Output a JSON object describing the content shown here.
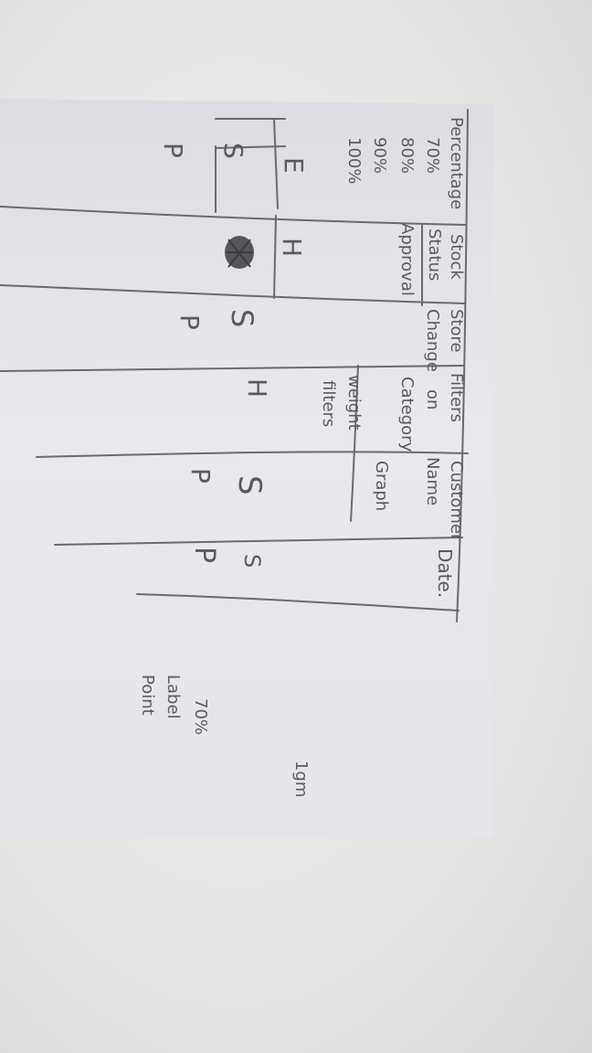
{
  "columns": [
    {
      "header_lines": [
        "Percentage",
        "70%",
        "80%",
        "90%",
        "100%"
      ],
      "cells": [
        "E",
        "S",
        "P"
      ]
    },
    {
      "header_lines": [
        "Stock",
        "Status",
        "Approval"
      ],
      "cells": [
        "H",
        ""
      ]
    },
    {
      "header_lines": [
        "Store",
        "Change"
      ],
      "cells": [
        "S",
        "P"
      ]
    },
    {
      "header_lines": [
        "Filters",
        "on",
        "Category",
        "weight",
        "filters"
      ],
      "cells": [
        "H"
      ]
    },
    {
      "header_lines": [
        "Customer",
        "Name",
        "Graph"
      ],
      "cells": [
        "S",
        "P"
      ]
    },
    {
      "header_lines": [
        "Date."
      ],
      "cells": [
        "S",
        "P"
      ]
    }
  ],
  "side_note": [
    "70%",
    "Label",
    "Point"
  ],
  "corner_note": "1gm",
  "colors": {
    "ink": "#5a5a5e",
    "paper": "#e6e7ec",
    "table": "#dfe0e5"
  }
}
